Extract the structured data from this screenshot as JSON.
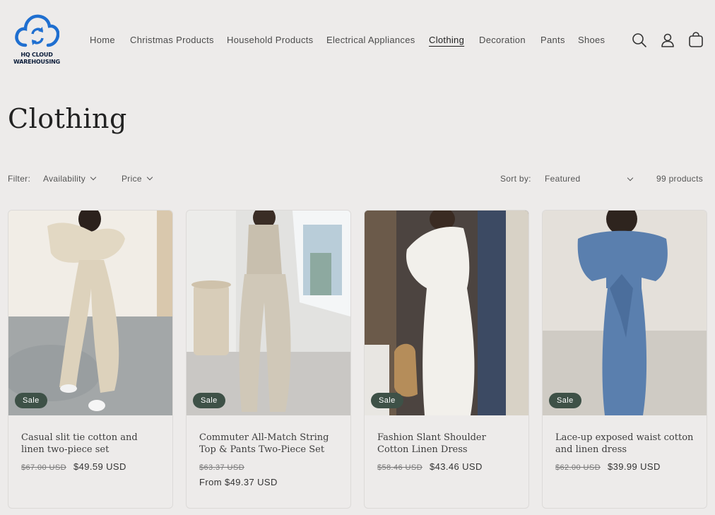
{
  "brand": {
    "logo_text_line1": "HQ CLOUD",
    "logo_text_line2": "WAREHOUSING",
    "logo_color": "#1f6fd0"
  },
  "nav": {
    "items": [
      {
        "label": "Home"
      },
      {
        "label": "Christmas Products"
      },
      {
        "label": "Household Products"
      },
      {
        "label": "Electrical Appliances"
      },
      {
        "label": "Clothing",
        "active": true
      },
      {
        "label": "Decoration"
      },
      {
        "label": "Pants"
      },
      {
        "label": "Shoes"
      }
    ]
  },
  "header_icons": [
    "search-icon",
    "account-icon",
    "cart-icon"
  ],
  "page": {
    "title": "Clothing"
  },
  "filters": {
    "filter_label": "Filter:",
    "availability": "Availability",
    "price": "Price",
    "sort_label": "Sort by:",
    "sort_value": "Featured",
    "count": "99 products"
  },
  "products": [
    {
      "name": "Casual slit tie cotton and linen two-piece set",
      "badge": "Sale",
      "old_price": "$67.00 USD",
      "price": "$49.59 USD",
      "from_price": ""
    },
    {
      "name": "Commuter All-Match String Top & Pants Two-Piece Set",
      "badge": "Sale",
      "old_price": "$63.37 USD",
      "price": "",
      "from_price": "From $49.37 USD"
    },
    {
      "name": "Fashion Slant Shoulder Cotton Linen Dress",
      "badge": "Sale",
      "old_price": "$58.46 USD",
      "price": "$43.46 USD",
      "from_price": ""
    },
    {
      "name": "Lace-up exposed waist cotton and linen dress",
      "badge": "Sale",
      "old_price": "$62.00 USD",
      "price": "$39.99 USD",
      "from_price": ""
    }
  ],
  "colors": {
    "background": "#edebea",
    "badge": "#3e5147"
  }
}
